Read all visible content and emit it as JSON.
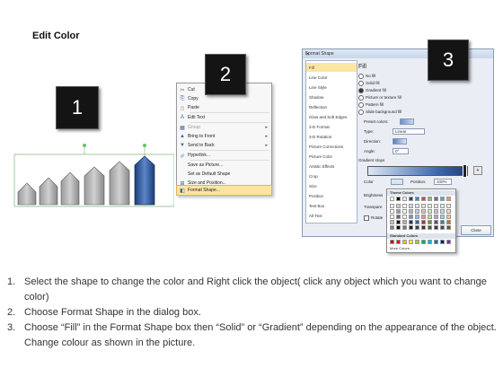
{
  "title": "Edit Color",
  "badges": [
    "1",
    "2",
    "3"
  ],
  "context_menu": {
    "items": [
      {
        "label": "Cut",
        "icon": "✂"
      },
      {
        "label": "Copy",
        "icon": "⎘"
      },
      {
        "label": "Paste",
        "icon": "📋"
      },
      {
        "label": "Edit Text",
        "icon": "A"
      },
      {
        "label": "Group",
        "icon": "▦"
      },
      {
        "label": "Bring to Front",
        "icon": "▲"
      },
      {
        "label": "Send to Back",
        "icon": "▼"
      },
      {
        "label": "Hyperlink...",
        "icon": "🔗"
      },
      {
        "label": "Save as Picture...",
        "icon": ""
      },
      {
        "label": "Set as Default Shape",
        "icon": ""
      },
      {
        "label": "Size and Position...",
        "icon": "⊞"
      },
      {
        "label": "Format Shape...",
        "icon": "◧"
      }
    ]
  },
  "dialog": {
    "title": "Format Shape",
    "close_glyph": "✕",
    "nav": [
      "Fill",
      "Line Color",
      "Line Style",
      "Shadow",
      "Reflection",
      "Glow and Soft Edges",
      "3-D Format",
      "3-D Rotation",
      "Picture Corrections",
      "Picture Color",
      "Artistic Effects",
      "Crop",
      "Size",
      "Position",
      "Text Box",
      "Alt Text"
    ],
    "section_title": "Fill",
    "fill_options": [
      "No fill",
      "Solid fill",
      "Gradient fill",
      "Picture or texture fill",
      "Pattern fill",
      "Slide background fill"
    ],
    "preset_colors_label": "Preset colors:",
    "type_label": "Type:",
    "type_value": "Linear",
    "direction_label": "Direction:",
    "angle_label": "Angle:",
    "angle_value": "0°",
    "gradient_stops_label": "Gradient stops",
    "color_label": "Color",
    "position_label": "Position:",
    "position_value": "100%",
    "brightness_label": "Brightness",
    "transparency_label": "Transpare",
    "rotate_label": "Rotate",
    "close_label": "Close"
  },
  "color_popup": {
    "theme_label": "Theme Colors",
    "standard_label": "Standard Colors",
    "more_label": "More Colors...",
    "theme_top": [
      "#ffffff",
      "#000000",
      "#eeece1",
      "#1f497d",
      "#4f81bd",
      "#c0504d",
      "#9bbb59",
      "#8064a2",
      "#4bacc6",
      "#f79646"
    ],
    "standard": [
      "#c00000",
      "#ff0000",
      "#ffc000",
      "#ffff00",
      "#92d050",
      "#00b050",
      "#00b0f0",
      "#0070c0",
      "#002060",
      "#7030a0"
    ]
  },
  "steps": [
    {
      "n": "1.",
      "text": "Select the shape to change the color and Right click the object( click any object which you want to change color)"
    },
    {
      "n": "2.",
      "text": "Choose Format Shape in the dialog box."
    },
    {
      "n": "3.",
      "text": "Choose “Fill” in the Format Shape box then “Solid” or “Gradient” depending on the appearance of the object. Change colour as shown in the picture."
    }
  ]
}
